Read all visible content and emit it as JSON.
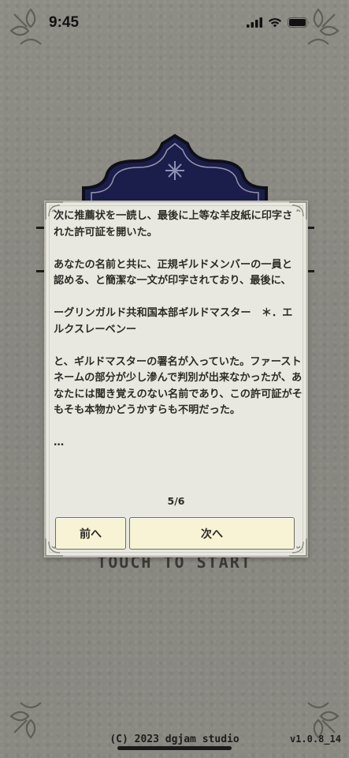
{
  "status_bar": {
    "time": "9:45",
    "icons": [
      "cellular-signal-icon",
      "wifi-icon",
      "battery-icon"
    ]
  },
  "background": {
    "touch_prompt": "TOUCH TO START",
    "copyright": "(C) 2023 dgjam studio",
    "version": "v1.0.8_14"
  },
  "dialog": {
    "text": "次に推薦状を一読し、最後に上等な羊皮紙に印字された許可証を開いた。\n\nあなたの名前と共に、正規ギルドメンバーの一員と認める、と簡潔な一文が印字されており、最後に、\n\nーグリンガルド共和国本部ギルドマスター　＊．エルクスレーベンー\n\nと、ギルドマスターの署名が入っていた。ファーストネームの部分が少し滲んで判別が出来なかったが、あなたには聞き覚えのない名前であり、この許可証がそもそも本物かどうかすらも不明だった。\n\n…",
    "page_indicator": "5/6",
    "prev_label": "前へ",
    "next_label": "次へ"
  },
  "colors": {
    "background": "#8b8a82",
    "dialog_bg": "#e9e8e0",
    "button_bg": "#f7f3d4",
    "emblem_navy": "#1b1e4a"
  }
}
